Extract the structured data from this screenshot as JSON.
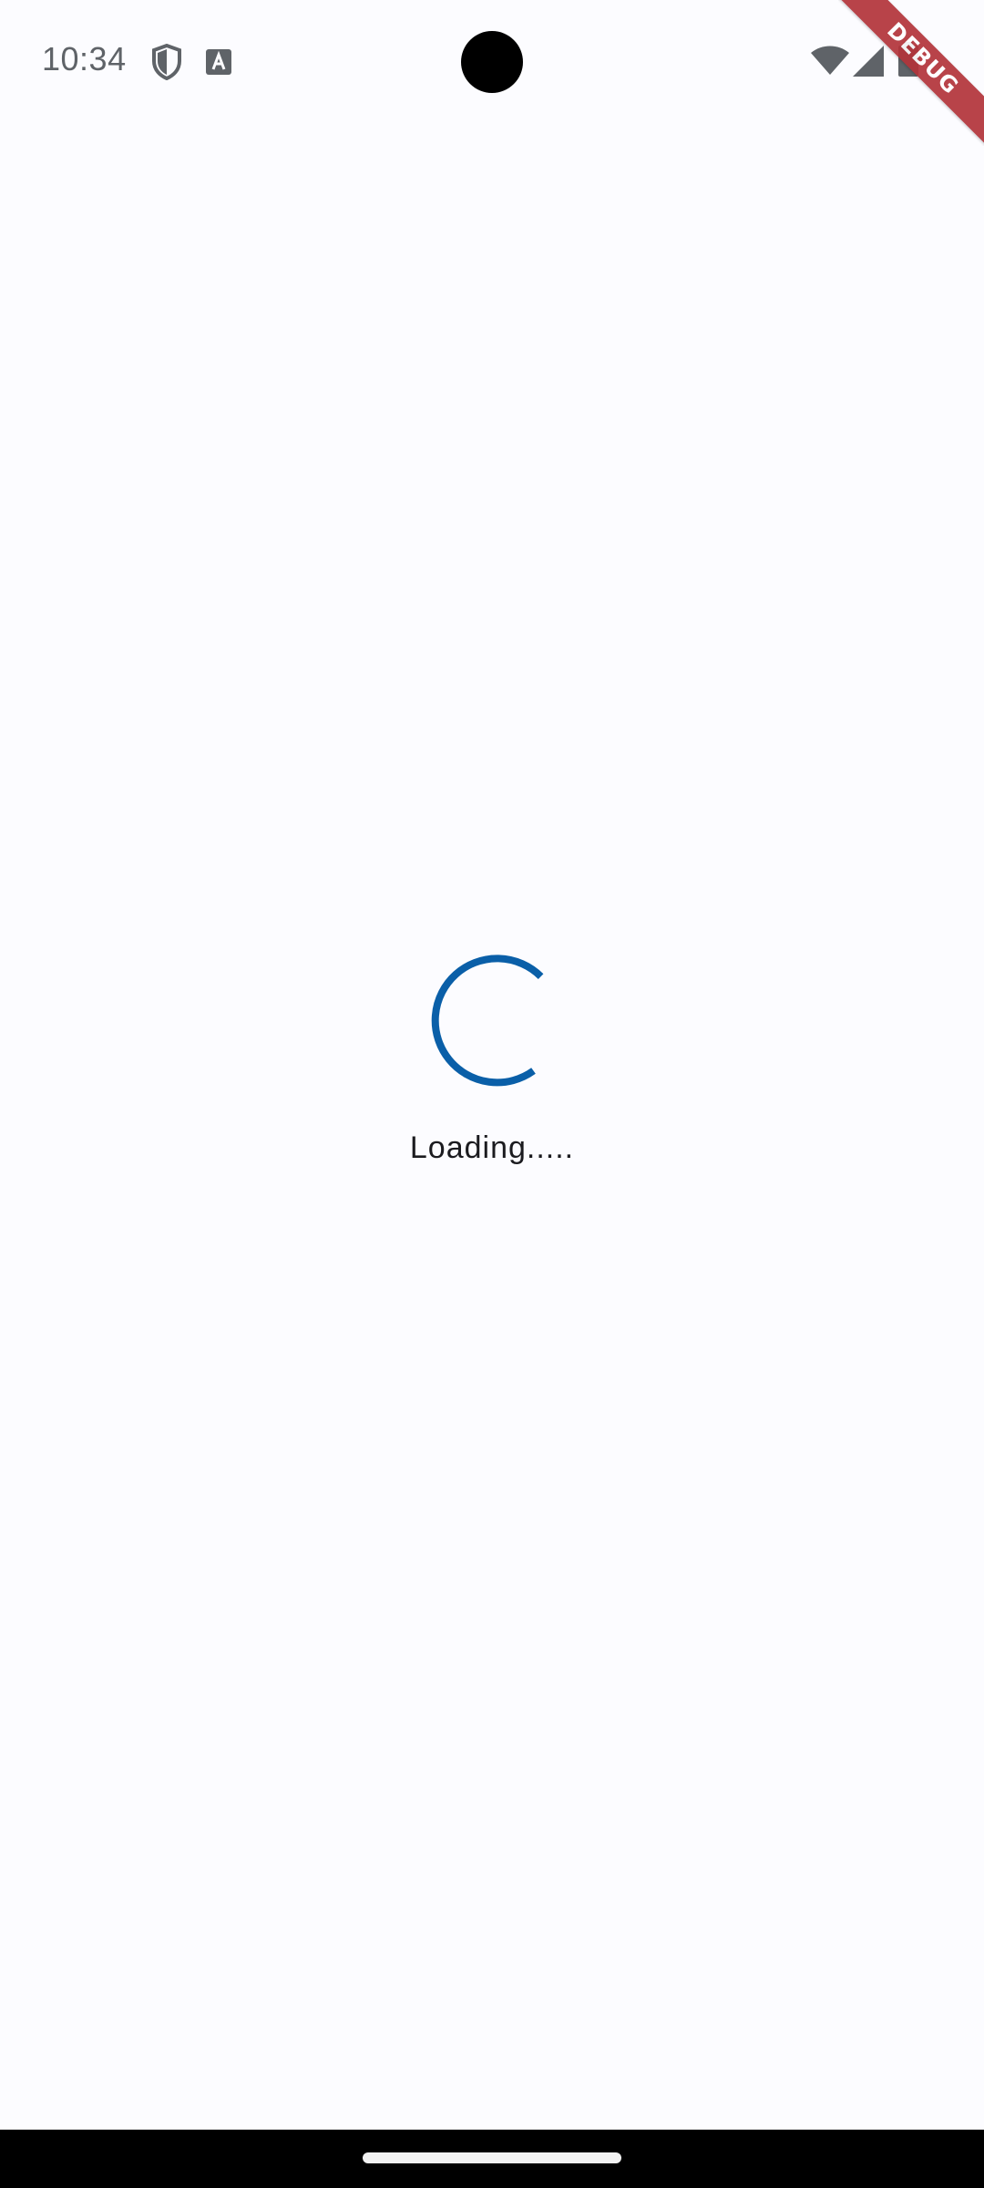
{
  "status_bar": {
    "time": "10:34",
    "left_icons": [
      "shield-icon",
      "a-notification-icon"
    ],
    "right_icons": [
      "wifi-icon",
      "signal-icon",
      "battery-icon"
    ]
  },
  "debug_banner": {
    "label": "DEBUG",
    "color": "#b3343a"
  },
  "loading": {
    "message": "Loading.....",
    "spinner_color": "#0a5fa8"
  },
  "colors": {
    "background": "#fcfcff",
    "nav_bar": "#000000"
  }
}
